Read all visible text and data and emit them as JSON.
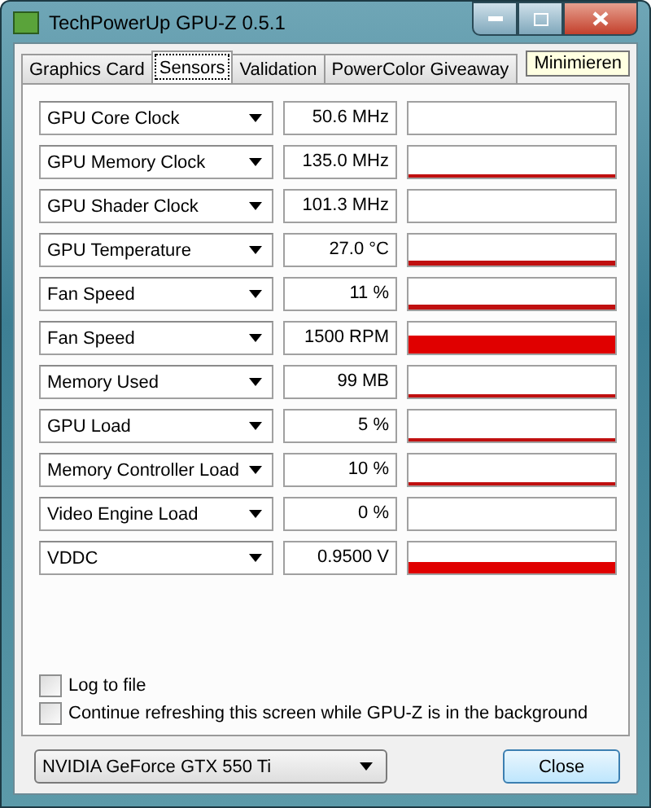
{
  "window": {
    "title": "TechPowerUp GPU-Z 0.5.1"
  },
  "tabs": [
    {
      "label": "Graphics Card",
      "selected": false
    },
    {
      "label": "Sensors",
      "selected": true
    },
    {
      "label": "Validation",
      "selected": false
    },
    {
      "label": "PowerColor Giveaway",
      "selected": false
    }
  ],
  "tooltip": "Minimieren",
  "sensors": [
    {
      "name": "GPU Core Clock",
      "reading": "50.6 MHz",
      "kind": "empty"
    },
    {
      "name": "GPU Memory Clock",
      "reading": "135.0 MHz",
      "kind": "thin"
    },
    {
      "name": "GPU Shader Clock",
      "reading": "101.3 MHz",
      "kind": "empty"
    },
    {
      "name": "GPU Temperature",
      "reading": "27.0 °C",
      "kind": "low"
    },
    {
      "name": "Fan Speed",
      "reading": "11 %",
      "kind": "low"
    },
    {
      "name": "Fan Speed",
      "reading": "1500 RPM",
      "kind": "high"
    },
    {
      "name": "Memory Used",
      "reading": "99 MB",
      "kind": "thin"
    },
    {
      "name": "GPU Load",
      "reading": "5 %",
      "kind": "thin"
    },
    {
      "name": "Memory Controller Load",
      "reading": "10 %",
      "kind": "thin"
    },
    {
      "name": "Video Engine Load",
      "reading": "0 %",
      "kind": "empty"
    },
    {
      "name": "VDDC",
      "reading": "0.9500 V",
      "kind": "mid"
    }
  ],
  "options": [
    {
      "label": "Log to file",
      "checked": false
    },
    {
      "label": "Continue refreshing this screen while GPU-Z is in the background",
      "checked": false
    }
  ],
  "device_select": {
    "value": "NVIDIA GeForce GTX 550 Ti"
  },
  "close_button": "Close"
}
